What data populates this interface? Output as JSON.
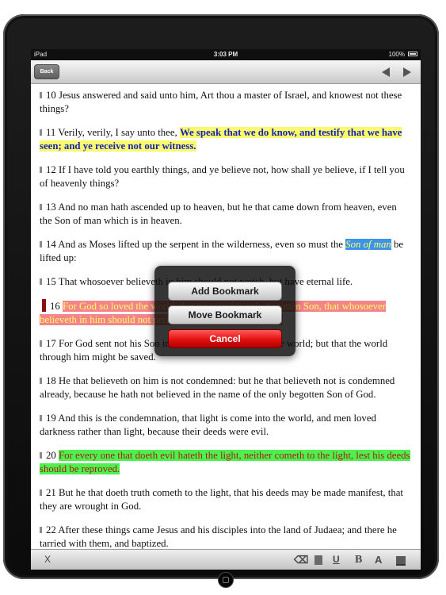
{
  "status_bar": {
    "carrier": "iPad",
    "time": "3:03 PM",
    "battery": "100%"
  },
  "nav": {
    "back_label": "Back"
  },
  "verses": [
    {
      "num": "10",
      "segments": [
        {
          "text": " Jesus answered and said unto him, Art thou a master of Israel, and knowest not these things?",
          "hl": ""
        }
      ]
    },
    {
      "num": "11",
      "segments": [
        {
          "text": " Verily, verily, I say unto thee, ",
          "hl": ""
        },
        {
          "text": "We speak that we do know, and testify that we have seen; and ye receive not our witness.",
          "hl": "yellow"
        }
      ]
    },
    {
      "num": "12",
      "segments": [
        {
          "text": " If I have told you earthly things, and ye believe not, how shall ye believe, if I tell you of heavenly things?",
          "hl": ""
        }
      ]
    },
    {
      "num": "13",
      "segments": [
        {
          "text": " And no man hath ascended up to heaven, but he that came down from heaven, even the Son of man which is in heaven.",
          "hl": ""
        }
      ]
    },
    {
      "num": "14",
      "segments": [
        {
          "text": " And as Moses lifted up the serpent in the wilderness, even so must the ",
          "hl": ""
        },
        {
          "text": "Son of man",
          "hl": "blue"
        },
        {
          "text": " be lifted up:",
          "hl": ""
        }
      ]
    },
    {
      "num": "15",
      "segments": [
        {
          "text": " That whosoever believeth in him should not perish, but have eternal life.",
          "hl": ""
        }
      ]
    },
    {
      "num": "16",
      "bookmark": true,
      "segments": [
        {
          "text": " ",
          "hl": ""
        },
        {
          "text": "For God so loved the world, that he gave his only begotten Son, that whosoever believeth in him should not perish, but have everlasting life.",
          "hl": "pink"
        }
      ]
    },
    {
      "num": "17",
      "segments": [
        {
          "text": " For God sent not his Son into the world to condemn the world; but that the world through him might be saved.",
          "hl": ""
        }
      ]
    },
    {
      "num": "18",
      "segments": [
        {
          "text": " He that believeth on him is not condemned: but he that believeth not is condemned already, because he hath not believed in the name of the only begotten Son of God.",
          "hl": ""
        }
      ]
    },
    {
      "num": "19",
      "segments": [
        {
          "text": " And this is the condemnation, that light is come into the world, and men loved darkness rather than light, because their deeds were evil.",
          "hl": ""
        }
      ]
    },
    {
      "num": "20",
      "segments": [
        {
          "text": " ",
          "hl": ""
        },
        {
          "text": "For every one that doeth evil hateth the light, neither cometh to the light, lest his deeds should be reproved.",
          "hl": "green"
        }
      ]
    },
    {
      "num": "21",
      "segments": [
        {
          "text": " But he that doeth truth cometh to the light, that his deeds may be made manifest, that they are wrought in God.",
          "hl": ""
        }
      ]
    },
    {
      "num": "22",
      "segments": [
        {
          "text": " After these things came Jesus and his disciples into the land of Judaea; and there he tarried with them, and baptized.",
          "hl": ""
        }
      ]
    }
  ],
  "action_sheet": {
    "add_label": "Add Bookmark",
    "move_label": "Move Bookmark",
    "cancel_label": "Cancel"
  },
  "toolbar": {
    "close_label": "X",
    "underline_label": "U",
    "bold_label": "B",
    "font_color_label": "A",
    "icons": [
      "eraser-icon",
      "highlighter-icon",
      "underline-icon",
      "bold-icon",
      "font-color-icon",
      "background-color-icon"
    ]
  },
  "highlight_colors": {
    "yellow": "#fbfb6e",
    "blue": "#3d93e8",
    "pink": "#f3848a",
    "green": "#4df14d",
    "cancel_red": "#e21010"
  }
}
